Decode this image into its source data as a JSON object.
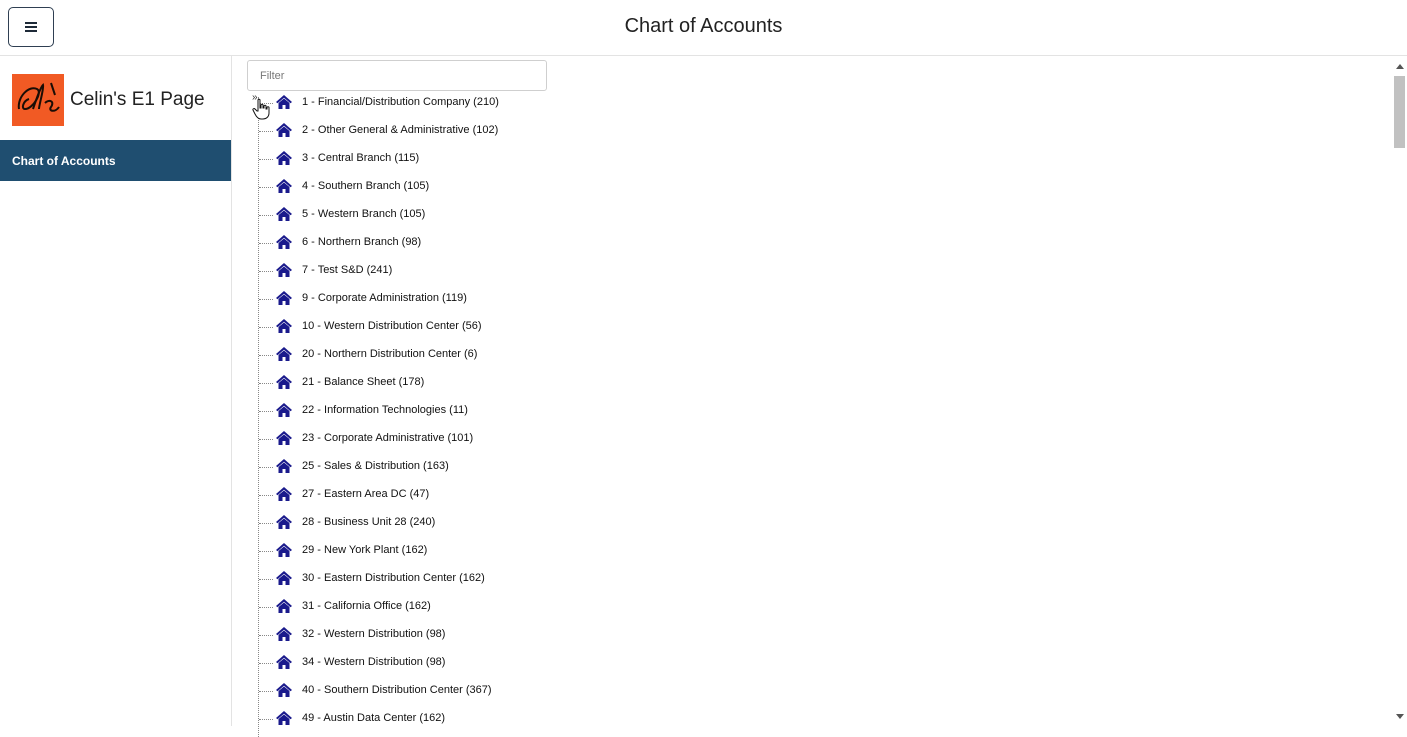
{
  "header": {
    "title": "Chart of Accounts",
    "menu_icon": "hamburger-menu-icon"
  },
  "sidebar": {
    "brand_name": "Celin's E1 Page",
    "logo_text": "elS",
    "logo_color": "#f15a24",
    "items": [
      {
        "label": "Chart of Accounts",
        "active": true
      }
    ]
  },
  "filter": {
    "placeholder": "Filter",
    "value": ""
  },
  "tree": {
    "node_icon": "home-icon",
    "icon_color": "#1a1a8c",
    "nodes": [
      {
        "label": "1 - Financial/Distribution Company (210)"
      },
      {
        "label": "2 - Other General & Administrative (102)"
      },
      {
        "label": "3 - Central Branch (115)"
      },
      {
        "label": "4 - Southern Branch (105)"
      },
      {
        "label": "5 - Western Branch (105)"
      },
      {
        "label": "6 - Northern Branch (98)"
      },
      {
        "label": "7 - Test S&D (241)"
      },
      {
        "label": "9 - Corporate Administration (119)"
      },
      {
        "label": "10 - Western Distribution Center (56)"
      },
      {
        "label": "20 - Northern Distribution Center (6)"
      },
      {
        "label": "21 - Balance Sheet (178)"
      },
      {
        "label": "22 - Information Technologies (11)"
      },
      {
        "label": "23 - Corporate Administrative (101)"
      },
      {
        "label": "25 - Sales & Distribution (163)"
      },
      {
        "label": "27 - Eastern Area DC (47)"
      },
      {
        "label": "28 - Business Unit 28 (240)"
      },
      {
        "label": "29 - New York Plant (162)"
      },
      {
        "label": "30 - Eastern Distribution Center (162)"
      },
      {
        "label": "31 - California Office (162)"
      },
      {
        "label": "32 - Western Distribution (98)"
      },
      {
        "label": "34 - Western Distribution (98)"
      },
      {
        "label": "40 - Southern Distribution Center (367)"
      },
      {
        "label": "49 - Austin Data Center (162)"
      }
    ]
  },
  "colors": {
    "nav_active_bg": "#1f4e70",
    "accent": "#1a1a8c"
  }
}
